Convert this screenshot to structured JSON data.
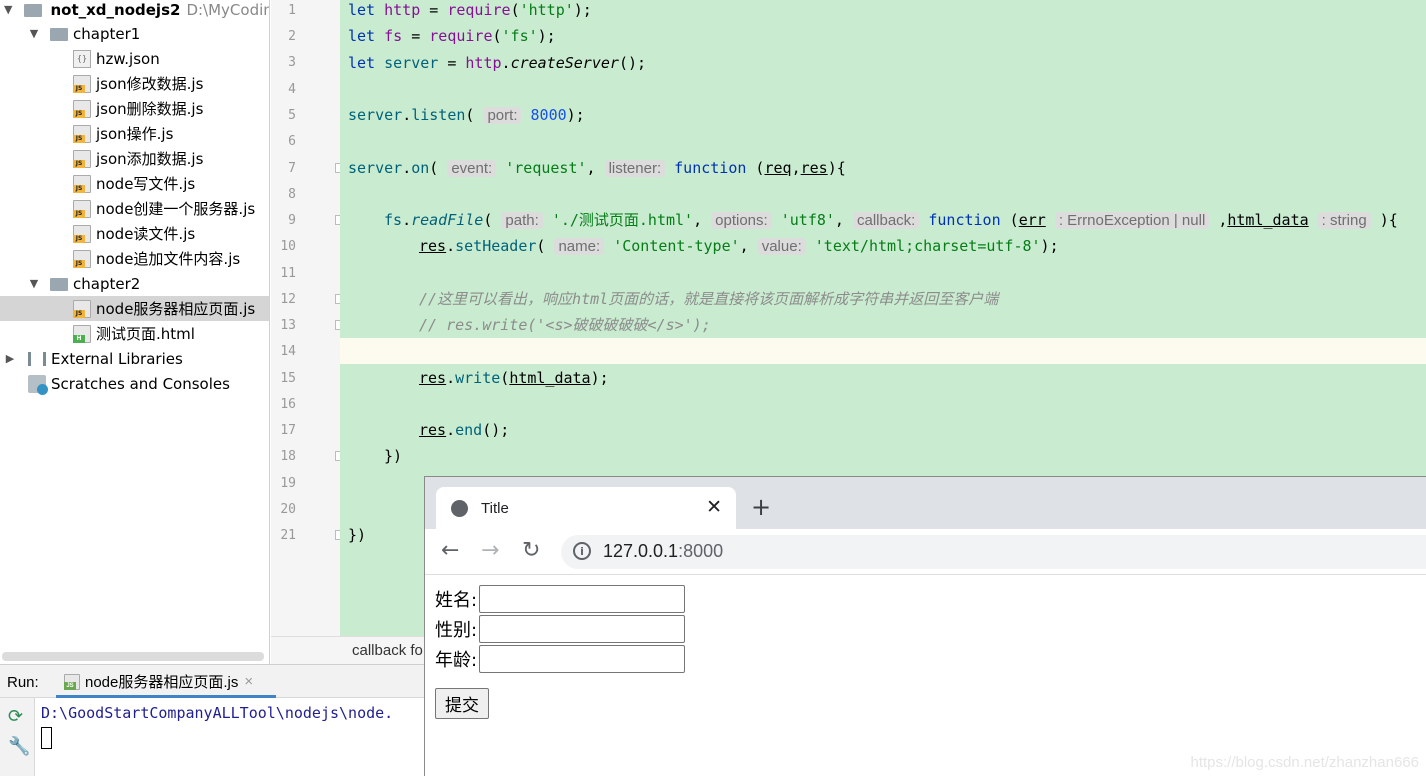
{
  "project": {
    "root": "not_xd_nodejs2",
    "root_path": "D:\\MyCoding",
    "folders": [
      {
        "name": "chapter1",
        "files": [
          "hzw.json",
          "json修改数据.js",
          "json删除数据.js",
          "json操作.js",
          "json添加数据.js",
          "node写文件.js",
          "node创建一个服务器.js",
          "node读文件.js",
          "node追加文件内容.js"
        ]
      },
      {
        "name": "chapter2",
        "files": [
          "node服务器相应页面.js",
          "测试页面.html"
        ]
      }
    ],
    "external_libraries": "External Libraries",
    "scratches": "Scratches and Consoles"
  },
  "editor": {
    "line_numbers": [
      "1",
      "2",
      "3",
      "4",
      "5",
      "6",
      "7",
      "8",
      "9",
      "10",
      "11",
      "12",
      "13",
      "14",
      "15",
      "16",
      "17",
      "18",
      "19",
      "20",
      "21"
    ],
    "line1": {
      "kw": "let",
      "var": "http",
      "op": " = ",
      "fn": "require",
      "open": "(",
      "str": "'http'",
      "close": ");"
    },
    "line2": {
      "kw": "let",
      "var": "fs",
      "op": " = ",
      "fn": "require",
      "open": "(",
      "str": "'fs'",
      "close": ");"
    },
    "line3": {
      "kw": "let",
      "var": "server",
      "op": " = ",
      "obj": "http",
      "dot": ".",
      "fn": "createServer",
      "close": "();"
    },
    "line5": {
      "obj": "server",
      "dot": ".",
      "fn": "listen",
      "open": "(",
      "hint": "port:",
      "num": "8000",
      "close": ");"
    },
    "line7": {
      "obj": "server",
      "dot": ".",
      "fn": "on",
      "open": "(",
      "hint1": "event:",
      "str": "'request'",
      "comma": ",",
      "hint2": "listener:",
      "kw": "function",
      "params1": " (",
      "p1": "req",
      "pc": ",",
      "p2": "res",
      "close": "){"
    },
    "line9": {
      "obj": "fs",
      "dot": ".",
      "fn": "readFile",
      "open": "(",
      "hint1": "path:",
      "str1": "'./测试页面.html'",
      "c1": ",",
      "hint2": "options:",
      "str2": "'utf8'",
      "c2": ",",
      "hint3": "callback:",
      "kw": "function",
      "po": " (",
      "p1": "err",
      "t1": ": ErrnoException | null",
      "pc": ",",
      "p2": "html_data",
      "t2": ": string",
      "close": "){"
    },
    "line10": {
      "obj": "res",
      "dot": ".",
      "fn": "setHeader",
      "open": "(",
      "hint1": "name:",
      "str1": "'Content-type'",
      "c1": ",",
      "hint2": "value:",
      "str2": "'text/html;charset=utf-8'",
      "close": ");"
    },
    "line12": "//这里可以看出，响应html页面的话，就是直接将该页面解析成字符串并返回至客户端",
    "line13": "// res.write('<s>破破破破破</s>');",
    "line15": {
      "obj": "res",
      "dot": ".",
      "fn": "write",
      "open": "(",
      "arg": "html_data",
      "close": ");"
    },
    "line17": {
      "obj": "res",
      "dot": ".",
      "fn": "end",
      "close": "();"
    },
    "line18": "})",
    "line21": "})",
    "breadcrumb": "callback fo"
  },
  "run": {
    "label": "Run:",
    "tab": "node服务器相应页面.js",
    "tab_close": "×",
    "console_path": "D:\\GoodStartCompanyALLTool\\nodejs\\node."
  },
  "browser": {
    "tab_title": "Title",
    "tab_close": "✕",
    "new_tab": "+",
    "back": "←",
    "forward": "→",
    "reload": "↻",
    "info": "i",
    "url_host": "127.0.0.1",
    "url_port": ":8000",
    "form": {
      "name_label": "姓名:",
      "gender_label": "性别:",
      "age_label": "年龄:",
      "submit": "提交"
    }
  },
  "watermark": "https://blog.csdn.net/zhanzhan666"
}
